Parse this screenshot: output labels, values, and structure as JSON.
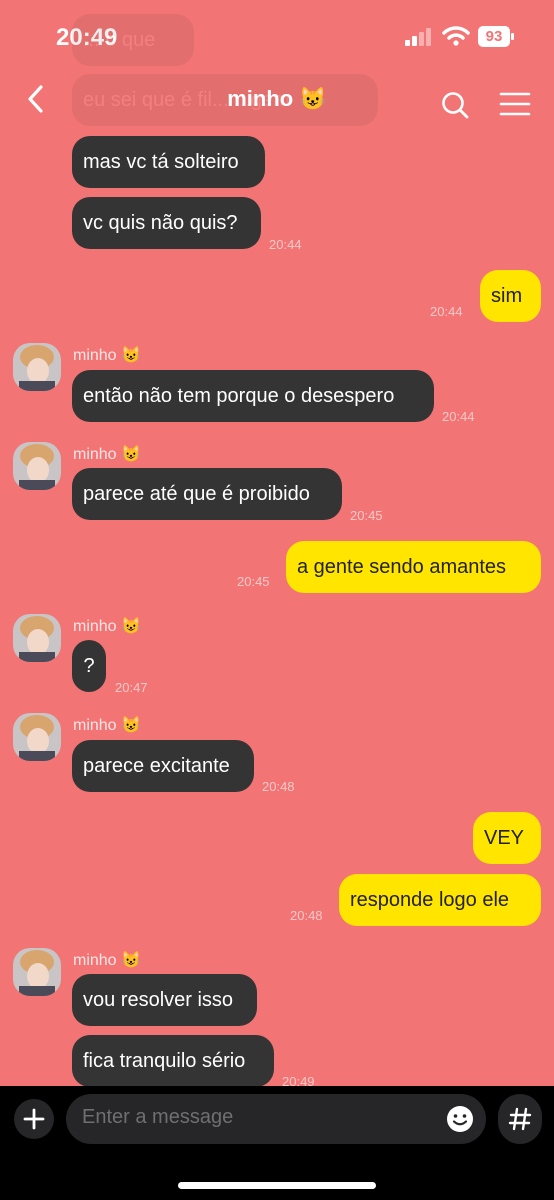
{
  "status_bar": {
    "time": "20:49",
    "battery": "93"
  },
  "header": {
    "title": "minho 😺"
  },
  "faded_messages": [
    "... o que",
    "eu sei que é fil... ...gem"
  ],
  "messages": [
    {
      "id": "m1",
      "text": "mas vc tá solteiro"
    },
    {
      "id": "m2",
      "text": "vc quis não quis?",
      "time": "20:44"
    },
    {
      "id": "m3",
      "text": "sim",
      "time": "20:44"
    },
    {
      "id": "m4",
      "sender": "minho 😺",
      "text": "então não tem porque o desespero",
      "time": "20:44"
    },
    {
      "id": "m5",
      "sender": "minho 😺",
      "text": "parece até que é proibido",
      "time": "20:45"
    },
    {
      "id": "m6",
      "text": "a gente sendo amantes",
      "time": "20:45"
    },
    {
      "id": "m7",
      "sender": "minho 😺",
      "text": "?",
      "time": "20:47"
    },
    {
      "id": "m8",
      "sender": "minho 😺",
      "text": "parece excitante",
      "time": "20:48"
    },
    {
      "id": "m9",
      "text": "VEY"
    },
    {
      "id": "m10",
      "text": "responde logo ele",
      "time": "20:48"
    },
    {
      "id": "m11",
      "sender": "minho 😺",
      "text": "vou resolver isso"
    },
    {
      "id": "m12",
      "text": "fica tranquilo sério",
      "time": "20:49"
    }
  ],
  "composer": {
    "placeholder": "Enter a message"
  },
  "icons": {
    "back": "chevron-left-icon",
    "search": "search-icon",
    "menu": "hamburger-menu-icon",
    "plus": "plus-icon",
    "emoji": "emoji-icon",
    "hashtag": "hashtag-icon"
  },
  "colors": {
    "background": "#f27474",
    "incoming": "#343434",
    "outgoing": "#ffe500",
    "bar": "#000000"
  }
}
